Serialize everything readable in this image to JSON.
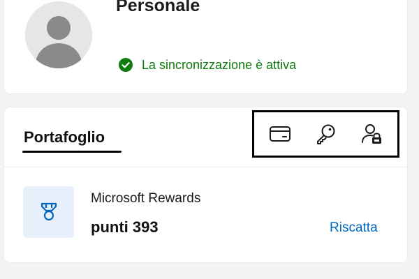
{
  "profile": {
    "name": "Personale",
    "avatar_icon": "person-silhouette-icon",
    "sync_status": "La sincronizzazione è attiva",
    "sync_icon": "check-circle-icon",
    "sync_color": "#107c10"
  },
  "wallet": {
    "tab_label": "Portafoglio",
    "actions": [
      {
        "icon": "credit-card-icon"
      },
      {
        "icon": "key-icon"
      },
      {
        "icon": "person-lock-icon"
      }
    ]
  },
  "rewards": {
    "icon": "medal-icon",
    "title": "Microsoft Rewards",
    "points": "punti 393",
    "action": "Riscatta",
    "link_color": "#0067c0"
  }
}
